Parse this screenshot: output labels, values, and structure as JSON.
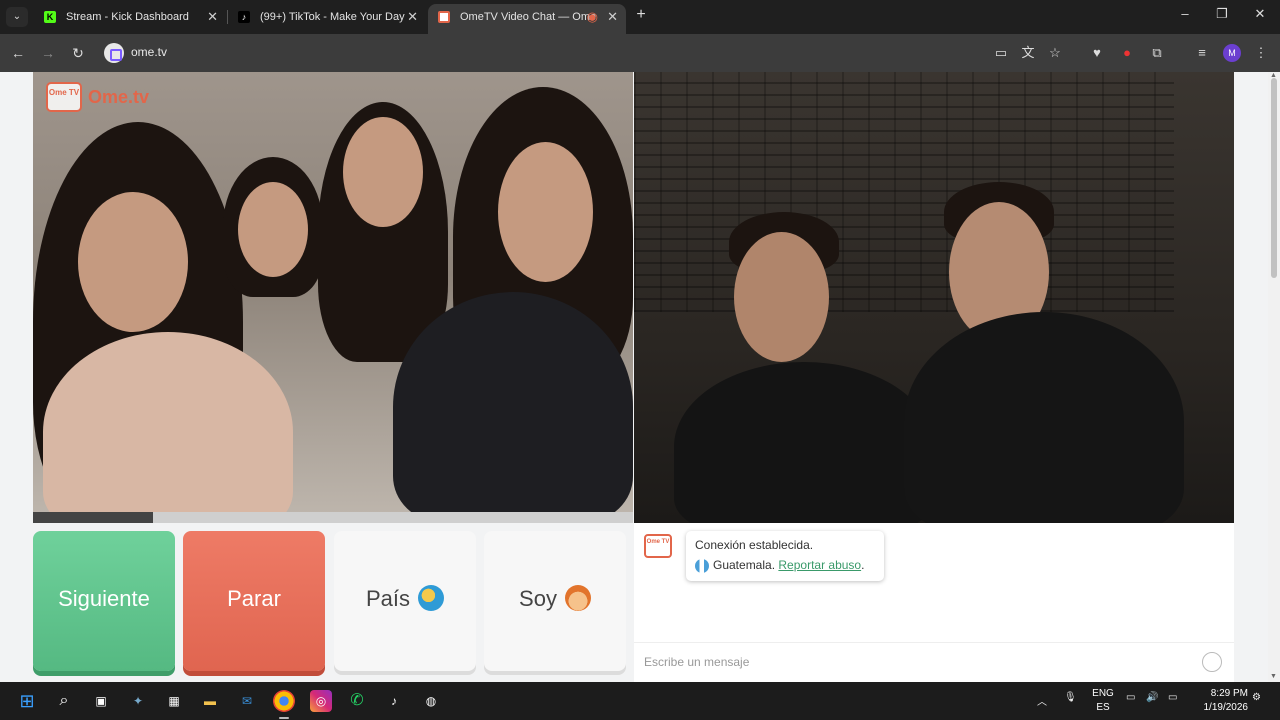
{
  "browser": {
    "tabs": [
      {
        "title": "Stream - Kick Dashboard",
        "icon": "kick-icon",
        "active": false
      },
      {
        "title": "(99+) TikTok - Make Your Day",
        "icon": "tiktok-icon",
        "active": false
      },
      {
        "title": "OmeTV Video Chat — Ome",
        "icon": "ometv-icon",
        "active": true
      }
    ],
    "url": "ome.tv"
  },
  "page": {
    "logo_text": "Ome.tv",
    "logo_badge": "Ome TV",
    "buttons": {
      "next": "Siguiente",
      "stop": "Parar",
      "country": "País",
      "gender": "Soy"
    },
    "chat": {
      "status": "Conexión establecida.",
      "country": "Guatemala.",
      "report": "Reportar abuso",
      "placeholder": "Escribe un mensaje"
    },
    "video_progress": 0.2
  },
  "taskbar": {
    "lang_top": "ENG",
    "lang_bottom": "ES",
    "time": "8:29 PM",
    "date": "1/19/2026"
  }
}
